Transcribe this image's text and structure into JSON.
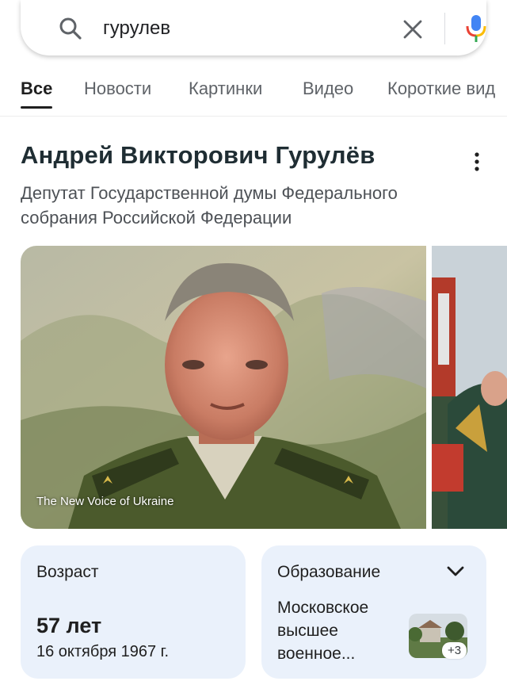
{
  "search": {
    "query": "гурулев",
    "icons": {
      "search": "search-icon",
      "clear": "close-icon",
      "mic": "mic-icon"
    }
  },
  "tabs": [
    {
      "label": "Все",
      "active": true
    },
    {
      "label": "Новости",
      "active": false
    },
    {
      "label": "Картинки",
      "active": false
    },
    {
      "label": "Видео",
      "active": false
    },
    {
      "label": "Короткие вид",
      "active": false
    }
  ],
  "panel": {
    "title": "Андрей Викторович Гурулёв",
    "subtitle": "Депутат Государственной думы Федерального собрания Российской Федерации",
    "menu_icon": "more-vert-icon",
    "image_caption": "The New Voice of Ukraine"
  },
  "cards": {
    "age": {
      "label": "Возраст",
      "value": "57 лет",
      "date": "16 октября 1967 г."
    },
    "education": {
      "label": "Образование",
      "value": "Московское высшее военное...",
      "more": "+3",
      "icon": "chevron-down-icon"
    }
  },
  "colors": {
    "accent_blue": "#4285f4",
    "accent_red": "#ea4335",
    "accent_yellow": "#fbbc05",
    "accent_green": "#34a853",
    "card_bg": "#eaf1fb"
  }
}
